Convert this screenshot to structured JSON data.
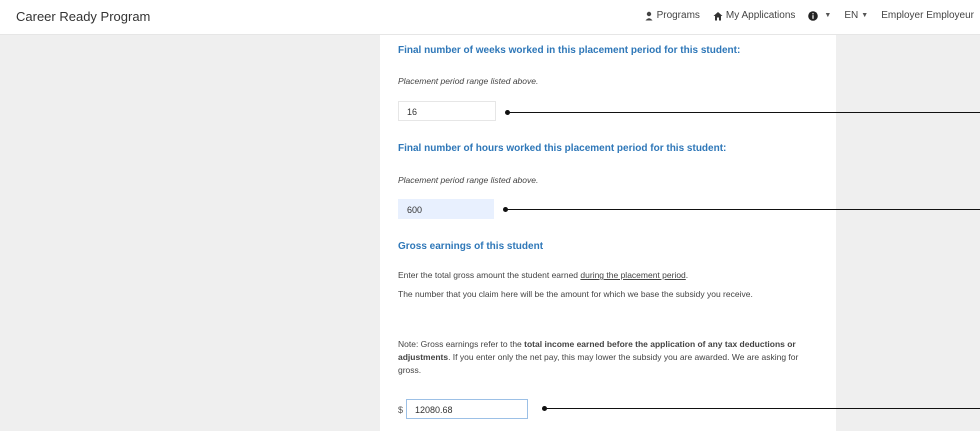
{
  "app": {
    "title": "Career Ready Program"
  },
  "nav": {
    "programs": "Programs",
    "my_applications": "My Applications",
    "language": "EN",
    "user": "Employer Employeur"
  },
  "form": {
    "weeks": {
      "title": "Final number of weeks worked in this placement period for this student:",
      "hint": "Placement period range listed above.",
      "value": "16"
    },
    "hours": {
      "title": "Final number of hours worked this placement period for this student:",
      "hint": "Placement period range listed above.",
      "value": "600"
    },
    "earnings": {
      "title": "Gross earnings of this student",
      "line1_prefix": "Enter the total gross amount the student earned ",
      "line1_link": "during the placement period",
      "line1_suffix": ".",
      "line2": "The number that you claim here will be the amount for which we base the subsidy you receive.",
      "note_prefix": "Note: Gross earnings refer to the ",
      "note_bold": "total income earned before the application of any tax deductions or adjustments",
      "note_suffix": ". If you enter only the net pay, this may lower the subsidy you are awarded. We are asking for gross.",
      "currency": "$",
      "value": "12080.68"
    }
  }
}
